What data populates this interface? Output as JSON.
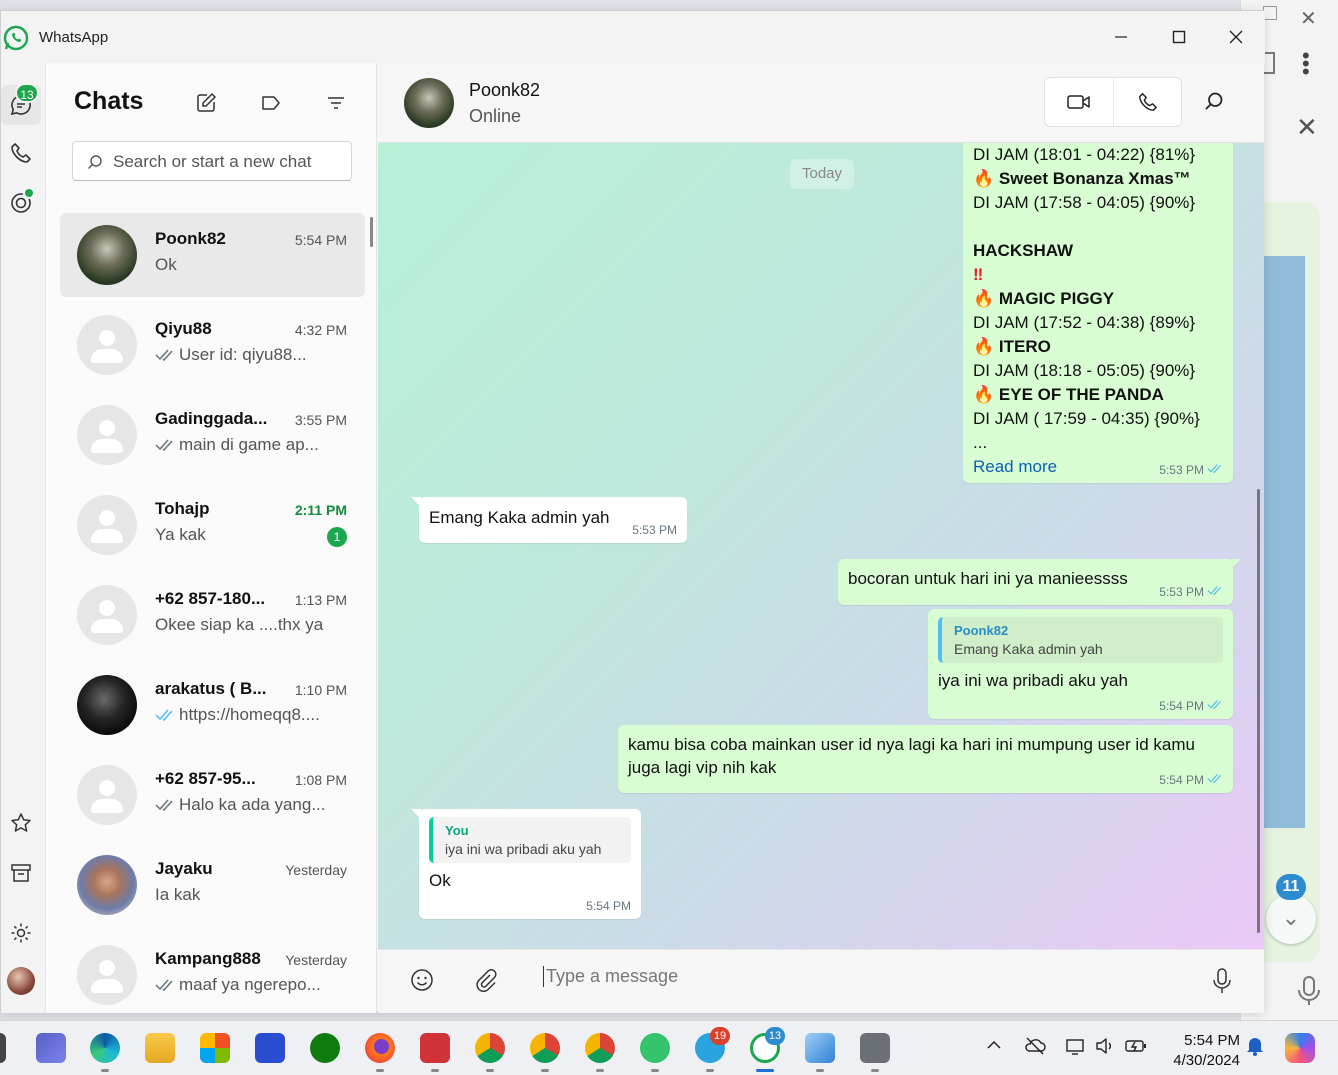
{
  "app": {
    "title": "WhatsApp"
  },
  "rail": {
    "chats_badge": "13"
  },
  "chatlist": {
    "title": "Chats",
    "search_placeholder": "Search or start a new chat",
    "chats": [
      {
        "name": "Poonk82",
        "time": "5:54 PM",
        "preview": "Ok",
        "ticks": "",
        "unread": ""
      },
      {
        "name": "Qiyu88",
        "time": "4:32 PM",
        "preview": "User id: qiyu88...",
        "ticks": "sent",
        "unread": ""
      },
      {
        "name": "Gadinggada...",
        "time": "3:55 PM",
        "preview": "main di game ap...",
        "ticks": "sent",
        "unread": ""
      },
      {
        "name": "Tohajp",
        "time": "2:11 PM",
        "preview": "Ya kak",
        "ticks": "",
        "unread": "1"
      },
      {
        "name": "+62 857-180...",
        "time": "1:13 PM",
        "preview": "Okee siap ka ....thx ya",
        "ticks": "",
        "unread": ""
      },
      {
        "name": "arakatus ( B...",
        "time": "1:10 PM",
        "preview": "https://homeqq8....",
        "ticks": "read",
        "unread": ""
      },
      {
        "name": "+62 857-95...",
        "time": "1:08 PM",
        "preview": "Halo ka ada yang...",
        "ticks": "sent",
        "unread": ""
      },
      {
        "name": "Jayaku",
        "time": "Yesterday",
        "preview": "Ia kak",
        "ticks": "",
        "unread": ""
      },
      {
        "name": "Kampang888",
        "time": "Yesterday",
        "preview": "maaf ya ngerepo...",
        "ticks": "sent",
        "unread": ""
      }
    ]
  },
  "conversation": {
    "name": "Poonk82",
    "status": "Online",
    "date_chip": "Today",
    "long_message": {
      "lines": [
        "DI JAM (18:01 -  04:22) {81%}",
        "Sweet Bonanza Xmas™",
        "DI JAM (17:58 - 04:05) {90%}",
        "",
        "HACKSHAW",
        "‼",
        "MAGIC PIGGY",
        "DI JAM (17:52 - 04:38) {89%}",
        "ITERO",
        "DI JAM (18:18 - 05:05) {90%}",
        "EYE OF THE PANDA",
        "DI JAM ( 17:59 - 04:35) {90%}",
        "..."
      ],
      "read_more": "Read more",
      "time": "5:53 PM"
    },
    "messages": [
      {
        "text": "Emang Kaka admin yah",
        "time": "5:53 PM",
        "dir": "in"
      },
      {
        "text": "bocoran untuk hari ini ya manieessss",
        "time": "5:53 PM",
        "dir": "out"
      },
      {
        "quote_author": "Poonk82",
        "quote_text": "Emang Kaka admin yah",
        "text": "iya ini wa pribadi aku yah",
        "time": "5:54 PM",
        "dir": "out"
      },
      {
        "text": "kamu bisa coba mainkan user id nya lagi ka hari ini mumpung user id kamu juga lagi vip nih kak",
        "time": "5:54 PM",
        "dir": "out"
      },
      {
        "quote_author": "You",
        "quote_text": "iya ini wa pribadi aku yah",
        "text": "Ok",
        "time": "5:54 PM",
        "dir": "in"
      }
    ],
    "composer_placeholder": "Type a message"
  },
  "background_window": {
    "badge": "11"
  },
  "taskbar": {
    "whatsapp_badge": "13",
    "telegram_badge": "19",
    "clock_time": "5:54 PM",
    "clock_date": "4/30/2024"
  },
  "colors": {
    "accent": "#1ca64d",
    "out_bubble": "#d9fdd3",
    "in_bubble": "#ffffff",
    "link": "#0b62b5"
  }
}
